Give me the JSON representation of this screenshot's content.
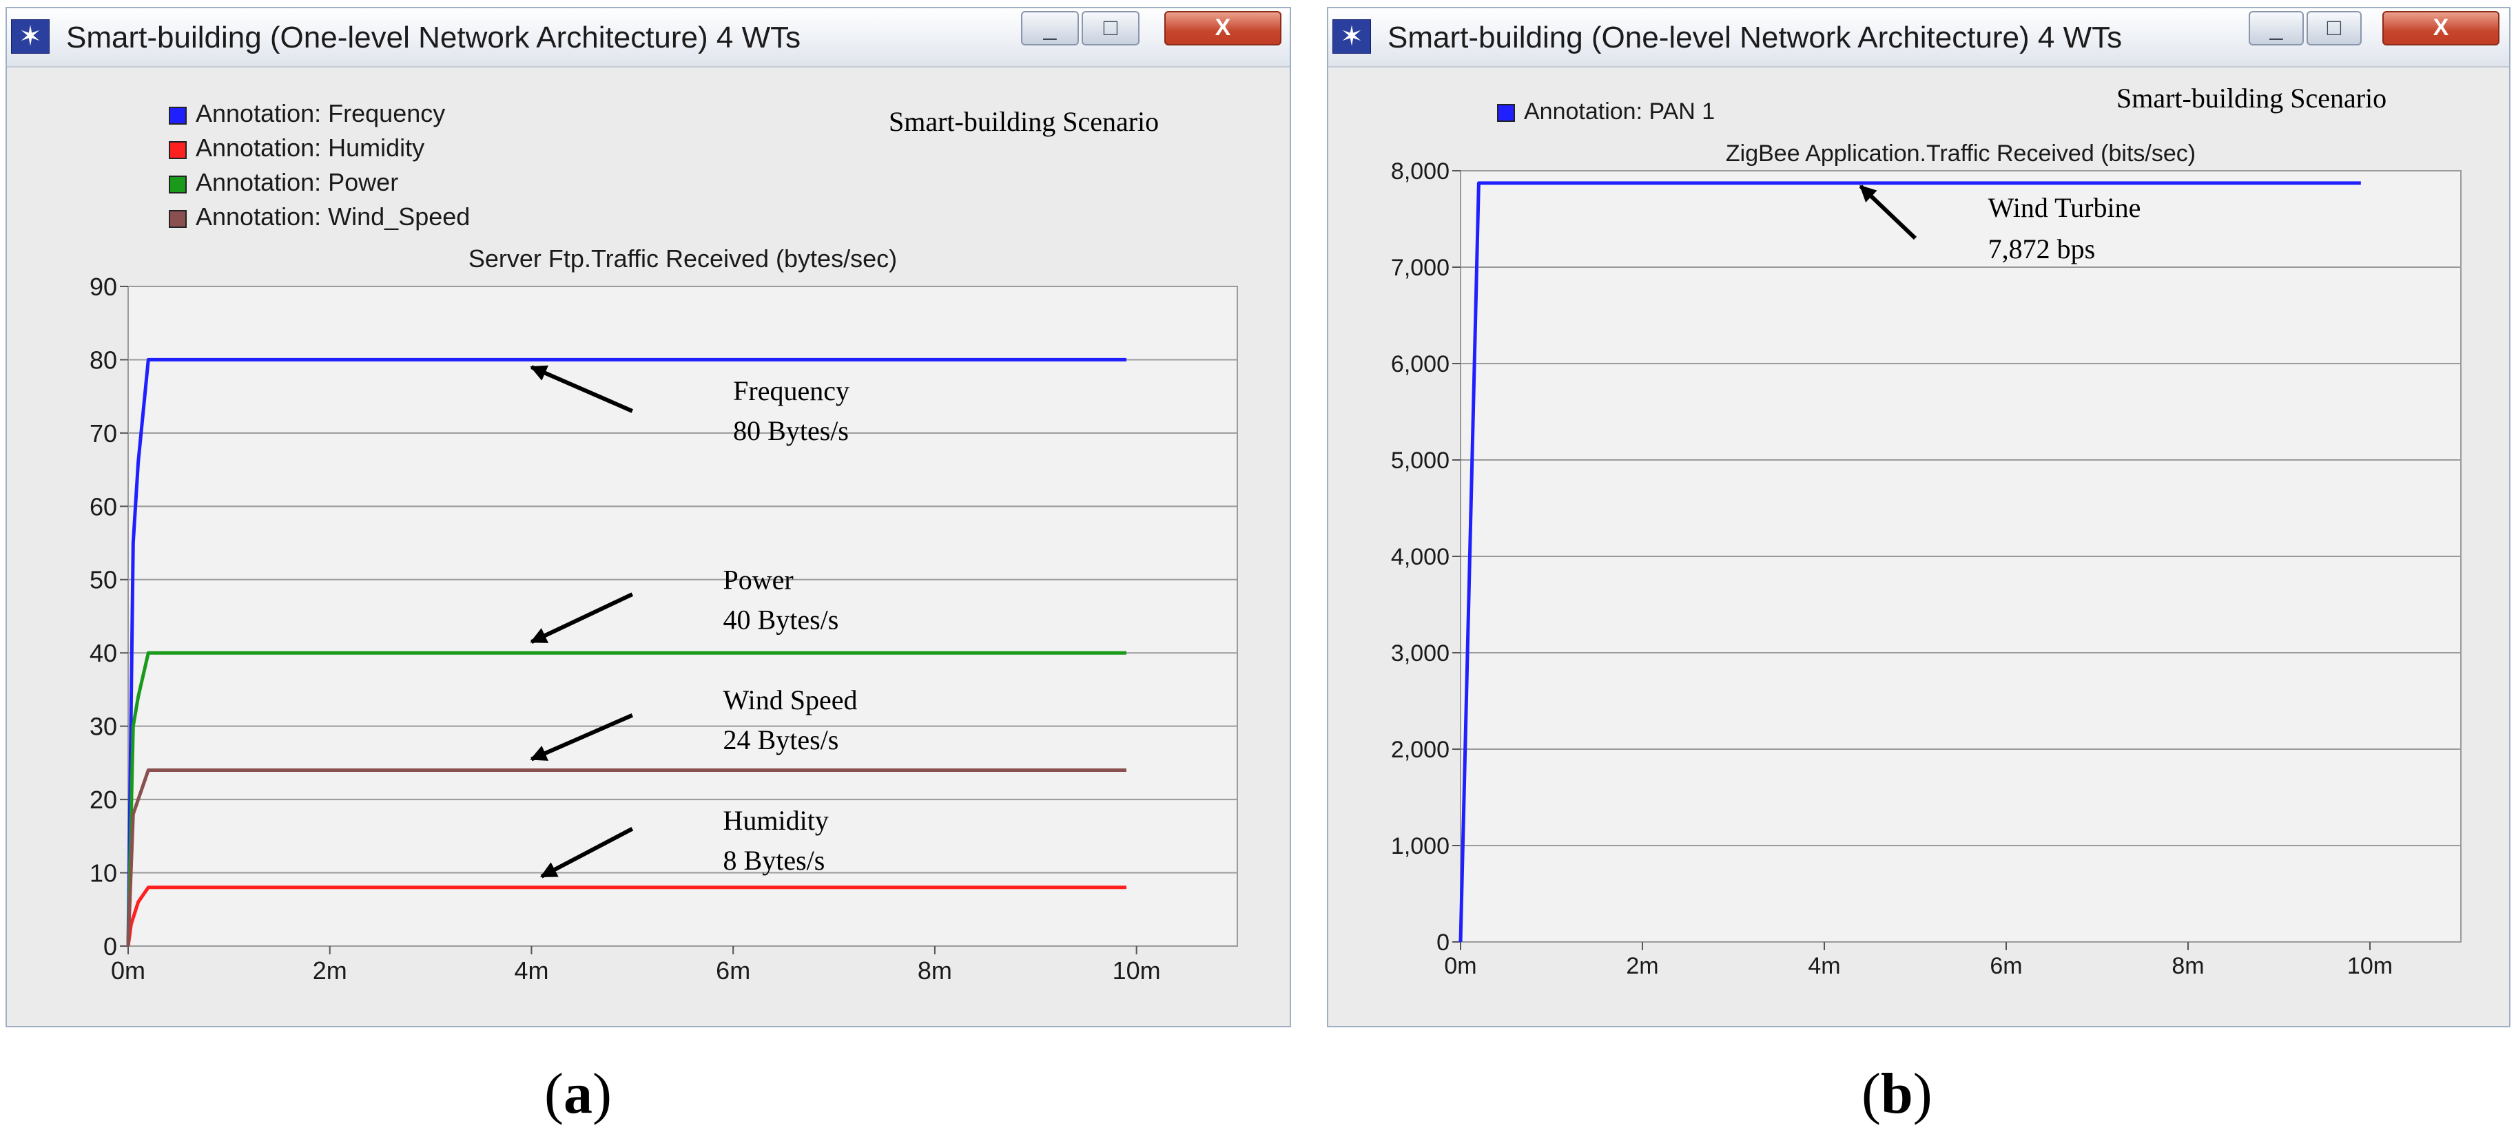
{
  "panels": [
    {
      "label_open": "(",
      "label_letter": "a",
      "label_close": ")",
      "window": {
        "title": "Smart-building (One-level Network Architecture) 4 WTs",
        "buttons": {
          "minimize": "_",
          "maximize": "□",
          "close": "X"
        }
      },
      "scenario": "Smart-building Scenario",
      "icon": "network-app-icon"
    },
    {
      "label_open": "(",
      "label_letter": "b",
      "label_close": ")",
      "window": {
        "title": "Smart-building (One-level Network Architecture) 4 WTs",
        "buttons": {
          "minimize": "_",
          "maximize": "□",
          "close": "X"
        }
      },
      "scenario": "Smart-building Scenario",
      "icon": "network-app-icon"
    }
  ],
  "chart_data": [
    {
      "type": "line",
      "title": "Server Ftp.Traffic Received (bytes/sec)",
      "xlabel": "",
      "ylabel": "",
      "x_unit": "minutes",
      "xlim": [
        0,
        11
      ],
      "ylim": [
        0,
        90
      ],
      "x_ticks": [
        0,
        2,
        4,
        6,
        8,
        10
      ],
      "x_tick_labels": [
        "0m",
        "2m",
        "4m",
        "6m",
        "8m",
        "10m"
      ],
      "y_ticks": [
        0,
        10,
        20,
        30,
        40,
        50,
        60,
        70,
        80,
        90
      ],
      "y_tick_labels": [
        "0",
        "10",
        "20",
        "30",
        "40",
        "50",
        "60",
        "70",
        "80",
        "90"
      ],
      "grid": "horizontal",
      "legend_position": "top-left",
      "series": [
        {
          "name": "Annotation: Frequency",
          "color": "#2020ff",
          "x": [
            0,
            0.05,
            0.1,
            0.2,
            9.9
          ],
          "y": [
            0,
            55,
            66,
            80,
            80
          ]
        },
        {
          "name": "Annotation: Humidity",
          "color": "#ff2020",
          "x": [
            0,
            0.03,
            0.1,
            0.2,
            9.9
          ],
          "y": [
            0,
            3,
            6,
            8,
            8
          ]
        },
        {
          "name": "Annotation: Power",
          "color": "#1a9a1a",
          "x": [
            0,
            0.05,
            0.1,
            0.2,
            9.9
          ],
          "y": [
            0,
            30,
            34,
            40,
            40
          ]
        },
        {
          "name": "Annotation: Wind_Speed",
          "color": "#8a5050",
          "x": [
            0,
            0.05,
            0.1,
            0.2,
            9.9
          ],
          "y": [
            0,
            18,
            20,
            24,
            24
          ]
        }
      ],
      "annotations": [
        {
          "lines": [
            "Frequency",
            "80 Bytes/s"
          ],
          "text_x": 6.0,
          "text_y": 74.5,
          "arrow_from": [
            5.0,
            73.0
          ],
          "arrow_to": [
            4.0,
            79.0
          ]
        },
        {
          "lines": [
            "Power",
            "40 Bytes/s"
          ],
          "text_x": 5.9,
          "text_y": 48.7,
          "arrow_from": [
            5.0,
            48.0
          ],
          "arrow_to": [
            4.0,
            41.5
          ]
        },
        {
          "lines": [
            "Wind Speed",
            "24 Bytes/s"
          ],
          "text_x": 5.9,
          "text_y": 32.3,
          "arrow_from": [
            5.0,
            31.5
          ],
          "arrow_to": [
            4.0,
            25.5
          ]
        },
        {
          "lines": [
            "Humidity",
            "8 Bytes/s"
          ],
          "text_x": 5.9,
          "text_y": 15.9,
          "arrow_from": [
            5.0,
            16.0
          ],
          "arrow_to": [
            4.1,
            9.5
          ]
        }
      ]
    },
    {
      "type": "line",
      "title": "ZigBee Application.Traffic Received (bits/sec)",
      "xlabel": "",
      "ylabel": "",
      "x_unit": "minutes",
      "xlim": [
        0,
        11
      ],
      "ylim": [
        0,
        8000
      ],
      "x_ticks": [
        0,
        2,
        4,
        6,
        8,
        10
      ],
      "x_tick_labels": [
        "0m",
        "2m",
        "4m",
        "6m",
        "8m",
        "10m"
      ],
      "y_ticks": [
        0,
        1000,
        2000,
        3000,
        4000,
        5000,
        6000,
        7000,
        8000
      ],
      "y_tick_labels": [
        "0",
        "1,000",
        "2,000",
        "3,000",
        "4,000",
        "5,000",
        "6,000",
        "7,000",
        "8,000"
      ],
      "grid": "horizontal",
      "legend_position": "top-left",
      "series": [
        {
          "name": "Annotation: PAN 1",
          "color": "#2020ff",
          "x": [
            0,
            0.2,
            9.9
          ],
          "y": [
            0,
            7872,
            7872
          ]
        }
      ],
      "annotations": [
        {
          "lines": [
            "Wind Turbine",
            "7,872 bps"
          ],
          "text_x": 5.8,
          "text_y": 7520,
          "arrow_from": [
            5.0,
            7300
          ],
          "arrow_to": [
            4.4,
            7840
          ]
        }
      ]
    }
  ]
}
